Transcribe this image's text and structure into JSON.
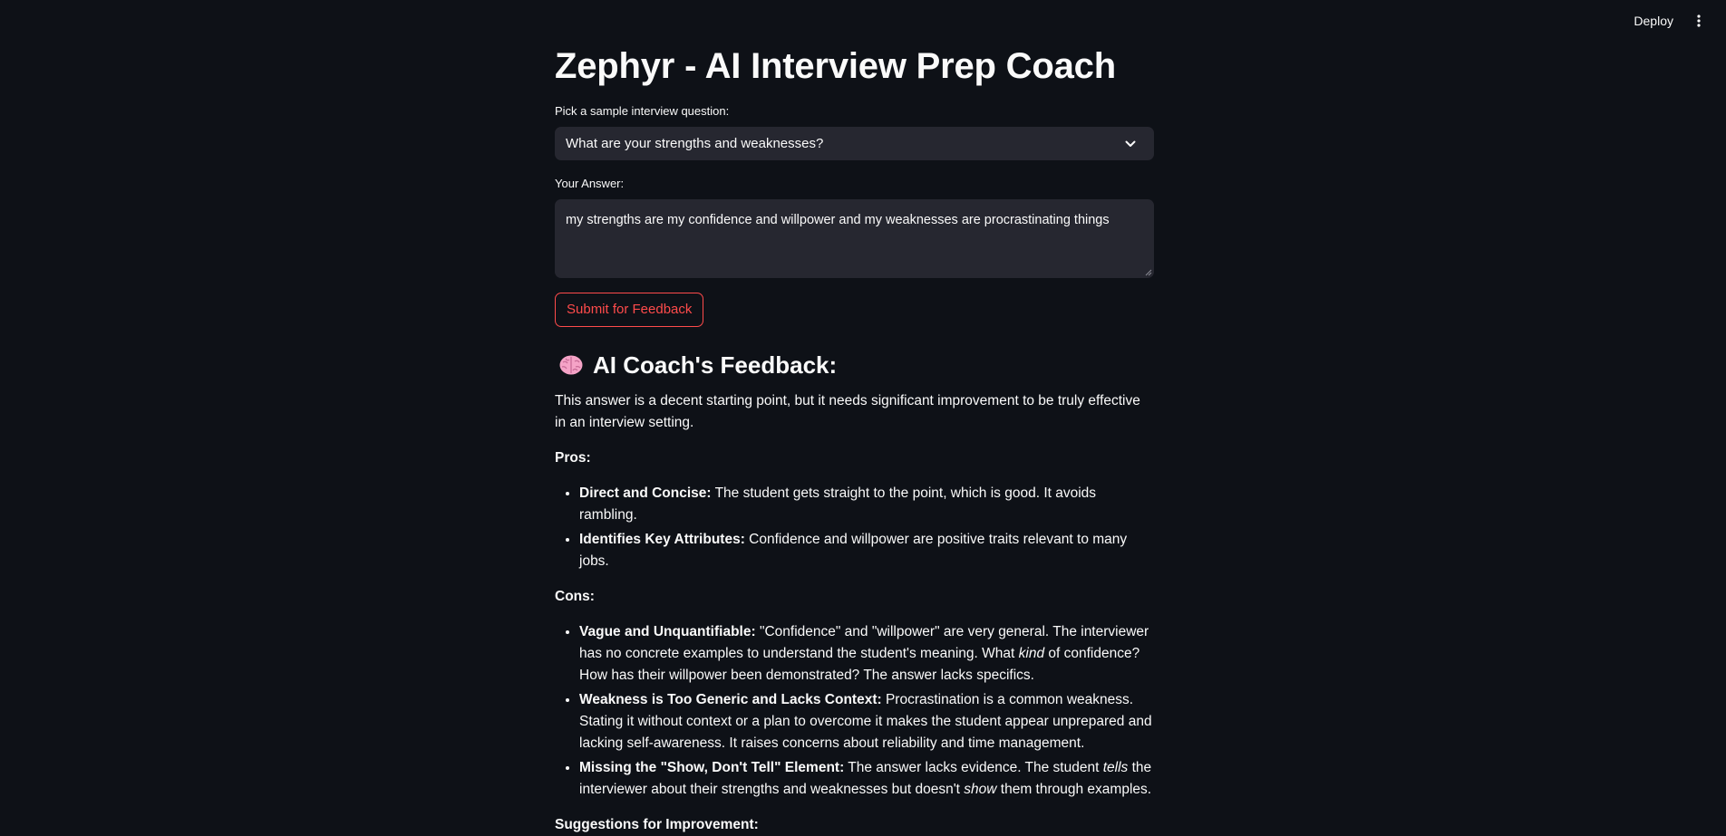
{
  "header": {
    "deploy_label": "Deploy",
    "menu_icon": "vertical-ellipsis-icon"
  },
  "page": {
    "title": "Zephyr - AI Interview Prep Coach"
  },
  "question_select": {
    "label": "Pick a sample interview question:",
    "value": "What are your strengths and weaknesses?",
    "icon": "chevron-down-icon"
  },
  "answer": {
    "label": "Your Answer:",
    "value": "my strengths are my confidence and willpower and my weaknesses are procrastinating things"
  },
  "submit": {
    "label": "Submit for Feedback"
  },
  "feedback": {
    "heading_icon": "brain-icon",
    "heading": "AI Coach's Feedback:",
    "intro": "This answer is a decent starting point, but it needs significant improvement to be truly effective in an interview setting.",
    "pros_heading": "Pros:",
    "pros": [
      {
        "title": "Direct and Concise:",
        "segments": [
          {
            "text": " The student gets straight to the point, which is good. It avoids rambling."
          }
        ]
      },
      {
        "title": "Identifies Key Attributes:",
        "segments": [
          {
            "text": " Confidence and willpower are positive traits relevant to many jobs."
          }
        ]
      }
    ],
    "cons_heading": "Cons:",
    "cons": [
      {
        "title": "Vague and Unquantifiable:",
        "segments": [
          {
            "text": " \"Confidence\" and \"willpower\" are very general. The interviewer has no concrete examples to understand the student's meaning. What "
          },
          {
            "text": "kind",
            "italic": true
          },
          {
            "text": " of confidence? How has their willpower been demonstrated? The answer lacks specifics."
          }
        ]
      },
      {
        "title": "Weakness is Too Generic and Lacks Context:",
        "segments": [
          {
            "text": " Procrastination is a common weakness. Stating it without context or a plan to overcome it makes the student appear unprepared and lacking self-awareness. It raises concerns about reliability and time management."
          }
        ]
      },
      {
        "title": "Missing the \"Show, Don't Tell\" Element:",
        "segments": [
          {
            "text": " The answer lacks evidence. The student "
          },
          {
            "text": "tells",
            "italic": true
          },
          {
            "text": " the interviewer about their strengths and weaknesses but doesn't "
          },
          {
            "text": "show",
            "italic": true
          },
          {
            "text": " them through examples."
          }
        ]
      }
    ],
    "suggestions_heading": "Suggestions for Improvement:"
  },
  "colors": {
    "background": "#0e1117",
    "input_bg": "#262730",
    "accent": "#ff4b4b",
    "text": "#fafafa"
  }
}
